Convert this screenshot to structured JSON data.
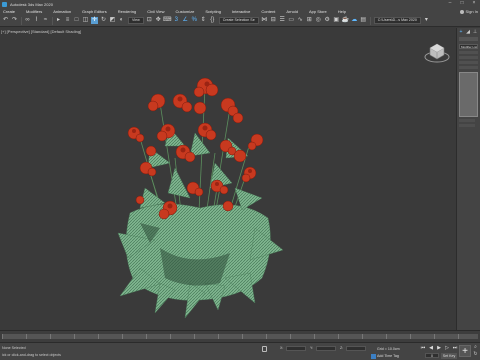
{
  "window": {
    "title": "Autodesk 3ds Max 2020"
  },
  "menu": {
    "items": [
      "Create",
      "Modifiers",
      "Animation",
      "Graph Editors",
      "Rendering",
      "Civil View",
      "Customize",
      "Scripting",
      "Interactive",
      "Content",
      "Arnold",
      "App Store",
      "Help"
    ],
    "signin": "Sign In"
  },
  "toolbar": {
    "view_dropdown": "View",
    "selection_set": "Create Selection Se",
    "workspace": "C:\\Users\\D...s Max 2020"
  },
  "viewport": {
    "label": "[+] [Perspective] [Standard] [Default Shading]"
  },
  "right_panel": {
    "modifier_list": "Modifier List"
  },
  "status": {
    "selection": "None Selected",
    "hint": "ick or click-and-drag to select objects",
    "grid": "Grid = 10.0cm",
    "add_time_tag": "Add Time Tag",
    "x_label": "X:",
    "y_label": "Y:",
    "z_label": "Z:",
    "frame": "0",
    "set_key": "Set Key",
    "auto": "Auto"
  }
}
